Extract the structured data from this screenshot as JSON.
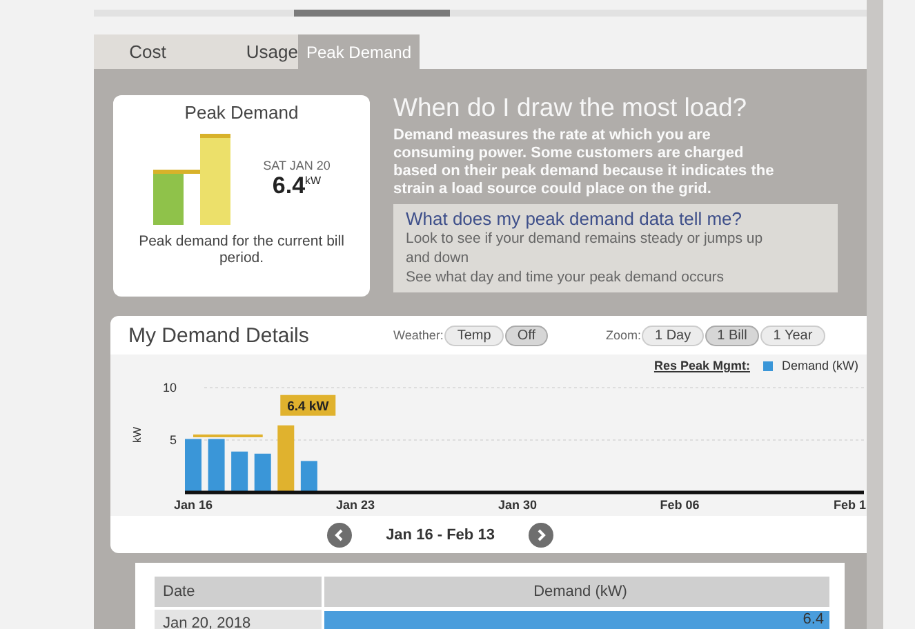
{
  "tabs": [
    {
      "label": "Cost",
      "selected": false
    },
    {
      "label": "Usage",
      "selected": false
    },
    {
      "label": "Peak Demand",
      "selected": true
    }
  ],
  "peak_card": {
    "title": "Peak Demand",
    "date": "SAT JAN 20",
    "value": "6.4$^{kW}$",
    "caption": "Peak demand for the current bill period."
  },
  "info": {
    "heading": "When do I draw the most load?",
    "text": "Demand measures the rate at which you are consuming power. Some customers are charged based on their peak demand because it indicates the strain a load source could place on the grid.",
    "question": {
      "title": "What does my peak demand data tell me?",
      "lines": [
        "Look to see if your demand remains steady or jumps up and down",
        "See what day and time your peak demand occurs"
      ]
    }
  },
  "details": {
    "title": "My Demand Details",
    "weather": {
      "label": "Weather:",
      "options": [
        {
          "label": "Temp",
          "selected": false
        },
        {
          "label": "Off",
          "selected": true
        }
      ]
    },
    "zoom": {
      "label": "Zoom:",
      "options": [
        {
          "label": "1 Day",
          "selected": false
        },
        {
          "label": "1 Bill",
          "selected": true
        },
        {
          "label": "1 Year",
          "selected": false
        }
      ]
    },
    "legend_title": "Res Peak Mgmt:",
    "chart_data": {
      "type": "bar",
      "ylabel": "kW",
      "categories": [
        "Jan 16",
        null,
        null,
        null,
        null,
        null,
        null,
        "Jan 23",
        null,
        null,
        null,
        null,
        null,
        null,
        "Jan 30",
        null,
        null,
        null,
        null,
        null,
        null,
        "Feb 06",
        null,
        null,
        null,
        null,
        null,
        null,
        "Feb 1"
      ],
      "series": [
        {
          "name": "Demand (kW)",
          "type": "bar",
          "color": "#3a96d8",
          "values": [
            5.1,
            5.1,
            3.9,
            3.7,
            null,
            3.0,
            null,
            null,
            null,
            null,
            null,
            null,
            null,
            null,
            null,
            null,
            null,
            null,
            null,
            null,
            null,
            null,
            null,
            null,
            null,
            null,
            null,
            null,
            null
          ]
        },
        {
          "type": "bar",
          "color": "#e0b22e",
          "values": [
            null,
            null,
            null,
            null,
            6.4,
            null,
            null,
            null,
            null,
            null,
            null,
            null,
            null,
            null,
            null,
            null,
            null,
            null,
            null,
            null,
            null,
            null,
            null,
            null,
            null,
            null,
            null,
            null,
            null
          ]
        },
        {
          "type": "line",
          "color": "#e0b22e",
          "values": [
            5.4,
            5.4,
            5.4,
            5.4,
            null,
            null,
            null,
            null,
            null,
            null,
            null,
            null,
            null,
            null,
            null,
            null,
            null,
            null,
            null,
            null,
            null,
            null,
            null,
            null,
            null,
            null,
            null,
            null,
            null
          ]
        }
      ],
      "ylim": [
        0,
        10
      ],
      "yticks": [
        5,
        10
      ],
      "annotations": [
        "6.4 kW"
      ]
    },
    "range": "Jan 16 - Feb 13"
  },
  "table": {
    "columns": [
      "Date",
      "Demand (kW)"
    ],
    "rows": [
      {
        "date": "Jan 20, 2018",
        "demand": "6.4",
        "level": 1.0
      }
    ]
  }
}
